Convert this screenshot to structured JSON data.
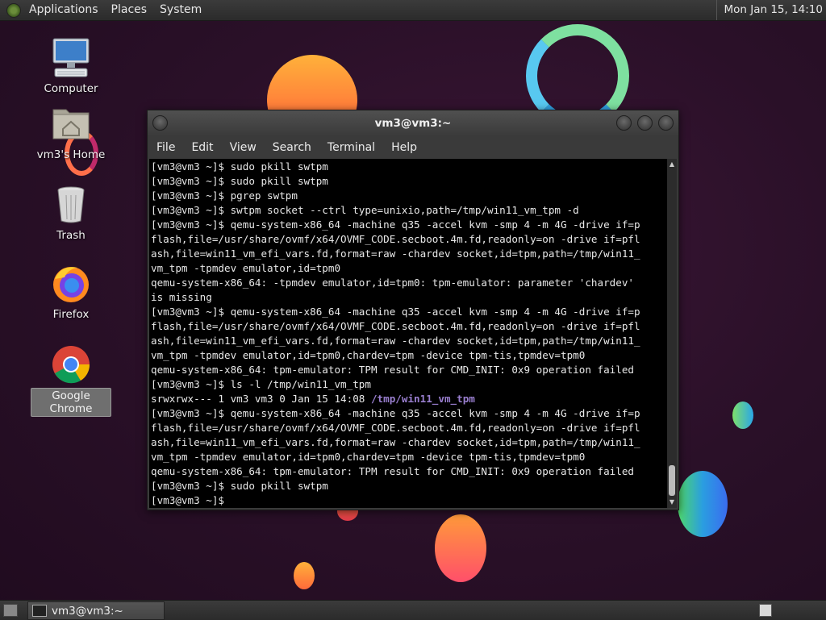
{
  "top_panel": {
    "menus": [
      "Applications",
      "Places",
      "System"
    ],
    "clock": "Mon Jan 15, 14:10"
  },
  "desktop_icons": [
    {
      "label": "Computer",
      "icon": "computer-icon"
    },
    {
      "label": "vm3's Home",
      "icon": "home-folder-icon"
    },
    {
      "label": "Trash",
      "icon": "trash-icon"
    },
    {
      "label": "Firefox",
      "icon": "firefox-icon"
    },
    {
      "label": "Google Chrome",
      "icon": "chrome-icon",
      "selected": true
    }
  ],
  "terminal": {
    "title": "vm3@vm3:~",
    "menus": [
      "File",
      "Edit",
      "View",
      "Search",
      "Terminal",
      "Help"
    ],
    "lines": [
      "[vm3@vm3 ~]$ sudo pkill swtpm",
      "[vm3@vm3 ~]$ sudo pkill swtpm",
      "[vm3@vm3 ~]$ pgrep swtpm",
      "[vm3@vm3 ~]$ swtpm socket --ctrl type=unixio,path=/tmp/win11_vm_tpm -d",
      "[vm3@vm3 ~]$ qemu-system-x86_64 -machine q35 -accel kvm -smp 4 -m 4G -drive if=p",
      "flash,file=/usr/share/ovmf/x64/OVMF_CODE.secboot.4m.fd,readonly=on -drive if=pfl",
      "ash,file=win11_vm_efi_vars.fd,format=raw -chardev socket,id=tpm,path=/tmp/win11_",
      "vm_tpm -tpmdev emulator,id=tpm0",
      "qemu-system-x86_64: -tpmdev emulator,id=tpm0: tpm-emulator: parameter 'chardev'",
      "is missing",
      "[vm3@vm3 ~]$ qemu-system-x86_64 -machine q35 -accel kvm -smp 4 -m 4G -drive if=p",
      "flash,file=/usr/share/ovmf/x64/OVMF_CODE.secboot.4m.fd,readonly=on -drive if=pfl",
      "ash,file=win11_vm_efi_vars.fd,format=raw -chardev socket,id=tpm,path=/tmp/win11_",
      "vm_tpm -tpmdev emulator,id=tpm0,chardev=tpm -device tpm-tis,tpmdev=tpm0",
      "qemu-system-x86_64: tpm-emulator: TPM result for CMD_INIT: 0x9 operation failed",
      "[vm3@vm3 ~]$ ls -l /tmp/win11_vm_tpm",
      "srwxrwx--- 1 vm3 vm3 0 Jan 15 14:08 ",
      "[vm3@vm3 ~]$ qemu-system-x86_64 -machine q35 -accel kvm -smp 4 -m 4G -drive if=p",
      "flash,file=/usr/share/ovmf/x64/OVMF_CODE.secboot.4m.fd,readonly=on -drive if=pfl",
      "ash,file=win11_vm_efi_vars.fd,format=raw -chardev socket,id=tpm,path=/tmp/win11_",
      "vm_tpm -tpmdev emulator,id=tpm0,chardev=tpm -device tpm-tis,tpmdev=tpm0",
      "qemu-system-x86_64: tpm-emulator: TPM result for CMD_INIT: 0x9 operation failed",
      "[vm3@vm3 ~]$ sudo pkill swtpm",
      "[vm3@vm3 ~]$ "
    ],
    "ls_socket_path": "/tmp/win11_vm_tpm"
  },
  "taskbar": {
    "task_label": "vm3@vm3:~"
  },
  "colors": {
    "panel_bg": "#2f2f2f",
    "terminal_bg": "#000000",
    "terminal_fg": "#e8e8e8",
    "directory_color": "#9a7fd0"
  }
}
